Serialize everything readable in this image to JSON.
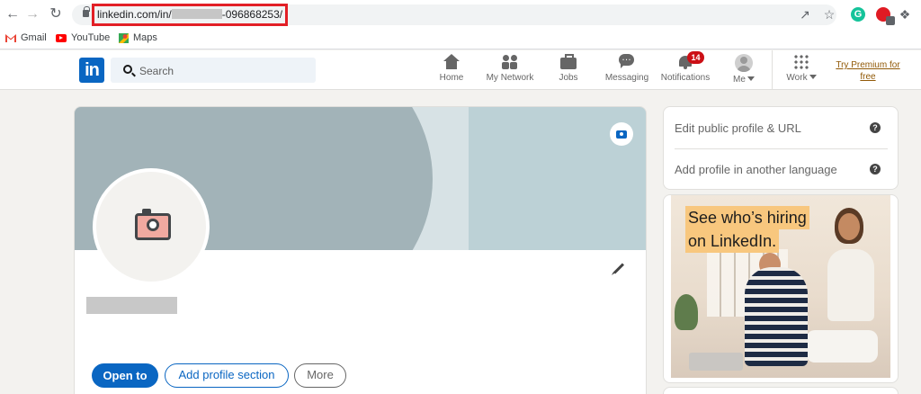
{
  "browser": {
    "url_prefix": "linkedin.com/in/",
    "url_suffix": "-096868253/",
    "bookmarks": [
      {
        "label": "Gmail",
        "icon": "gmail-icon"
      },
      {
        "label": "YouTube",
        "icon": "youtube-icon"
      },
      {
        "label": "Maps",
        "icon": "maps-icon"
      }
    ],
    "extension_g": "G"
  },
  "header": {
    "logo": "in",
    "search_placeholder": "Search",
    "nav": [
      {
        "label": "Home",
        "icon": "home-icon"
      },
      {
        "label": "My Network",
        "icon": "network-icon"
      },
      {
        "label": "Jobs",
        "icon": "jobs-icon"
      },
      {
        "label": "Messaging",
        "icon": "messaging-icon"
      },
      {
        "label": "Notifications",
        "icon": "bell-icon",
        "badge": "14"
      },
      {
        "label": "Me",
        "icon": "avatar-icon"
      },
      {
        "label": "Work",
        "icon": "grid-icon"
      }
    ],
    "premium_label": "Try Premium for free"
  },
  "profile": {
    "buttons": {
      "open_to": "Open to",
      "add_section": "Add profile section",
      "more": "More"
    }
  },
  "sidebar": {
    "rows": [
      {
        "label": "Edit public profile & URL"
      },
      {
        "label": "Add profile in another language"
      }
    ],
    "help_glyph": "?"
  },
  "ad": {
    "headline_line1": "See who’s hiring",
    "headline_line2": "on LinkedIn."
  },
  "colors": {
    "brand": "#0a66c2",
    "notification_badge": "#cc1016",
    "premium_link": "#915907",
    "url_highlight": "#e21f26"
  }
}
